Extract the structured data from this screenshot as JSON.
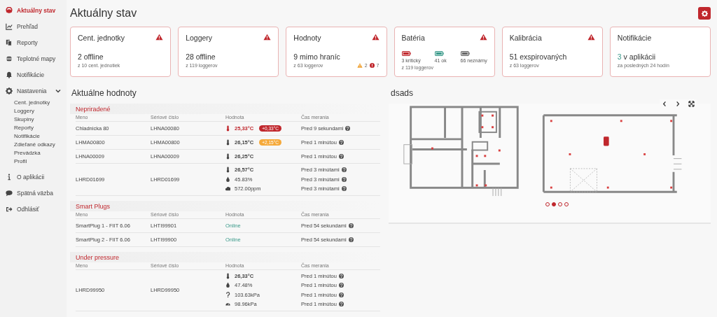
{
  "sidebar": {
    "items": [
      {
        "label": "Aktuálny stav",
        "selected": true
      },
      {
        "label": "Prehľad",
        "selected": false
      },
      {
        "label": "Reporty",
        "selected": false
      },
      {
        "label": "Teplotné mapy",
        "selected": false
      },
      {
        "label": "Notifikácie",
        "selected": false
      },
      {
        "label": "Nastavenia",
        "selected": false,
        "expanded": true,
        "children": [
          {
            "label": "Cent. jednotky",
            "selected": false
          },
          {
            "label": "Loggery",
            "selected": false
          },
          {
            "label": "Skupiny",
            "selected": false
          },
          {
            "label": "Reporty",
            "selected": false
          },
          {
            "label": "Notifikácie",
            "selected": false
          },
          {
            "label": "Zdieľané odkazy",
            "selected": false
          },
          {
            "label": "Prevádzka",
            "selected": false
          },
          {
            "label": "Profil",
            "selected": false
          }
        ]
      },
      {
        "label": "O aplikácii",
        "selected": false
      },
      {
        "label": "Spätná väzba",
        "selected": false
      },
      {
        "label": "Odhlásiť",
        "selected": false
      }
    ]
  },
  "page": {
    "title": "Aktuálny stav"
  },
  "cards": [
    {
      "kind": "stat",
      "title": "Cent. jednotky",
      "alert": true,
      "main": "2 offline",
      "sub": "z 10 cent. jednotiek"
    },
    {
      "kind": "stat",
      "title": "Loggery",
      "alert": true,
      "main": "28 offline",
      "sub": "z 119 loggerov"
    },
    {
      "kind": "stat",
      "title": "Hodnoty",
      "alert": true,
      "main": "9 mimo hraníc",
      "sub": "z 63 loggerov",
      "warnings": "2",
      "errors": "7"
    },
    {
      "kind": "battery",
      "title": "Batéria",
      "alert": true,
      "stats": [
        {
          "color": "#c0272d",
          "label": "3 kritický"
        },
        {
          "color": "#3a9a8a",
          "label": "41 ok"
        },
        {
          "color": "#666666",
          "label": "66 neznámy"
        }
      ],
      "sub": "z 119 loggerov"
    },
    {
      "kind": "stat",
      "title": "Kalibrácia",
      "alert": true,
      "main": "51 exspirovaných",
      "sub": "z 63 loggerov"
    },
    {
      "kind": "notify",
      "title": "Notifikácie",
      "alert": false,
      "count": "3",
      "main": "v aplikácii",
      "sub": "za posledných 24 hodín"
    }
  ],
  "values_section": {
    "title": "Aktuálne hodnoty",
    "groups": [
      {
        "title": "Nepriradené",
        "columns": [
          "Meno",
          "Sériové číslo",
          "Hodnota",
          "Čas merania"
        ],
        "rows": [
          {
            "name": "Chladnicka 80",
            "serial": "LHNA00080",
            "values": [
              {
                "kind": "temperature",
                "color": "#c0272d",
                "text": "25,33°C",
                "badge": {
                  "text": "+0,33°C",
                  "color": "#c0272d"
                },
                "time": "Pred 9 sekundami"
              }
            ]
          },
          {
            "name": "LHMA00800",
            "serial": "LHMA00800",
            "values": [
              {
                "kind": "temperature",
                "text": "26,15°C",
                "badge": {
                  "text": "+2,15°C",
                  "color": "#f5a93a"
                },
                "time": "Pred 1 minútou"
              }
            ]
          },
          {
            "name": "LHNA00009",
            "serial": "LHNA00009",
            "values": [
              {
                "kind": "temperature",
                "text": "26,25°C",
                "time": "Pred 1 minútou"
              }
            ]
          },
          {
            "name": "LHRD01699",
            "serial": "LHRD01699",
            "values": [
              {
                "kind": "temperature",
                "text": "26,57°C",
                "time": "Pred 3 minútami"
              },
              {
                "kind": "humidity",
                "text": "45.83%",
                "time": "Pred 3 minútami"
              },
              {
                "kind": "co2",
                "text": "572.00ppm",
                "time": "Pred 3 minútami"
              }
            ]
          }
        ]
      },
      {
        "title": "Smart Plugs",
        "columns": [
          "Meno",
          "Sériové číslo",
          "Hodnota",
          "Čas merania"
        ],
        "rows": [
          {
            "name": "SmartPlug 1 - FIIT 6.06",
            "serial": "LHTI99901",
            "values": [
              {
                "kind": "online",
                "text": "Online",
                "time": "Pred 54 sekundami"
              }
            ]
          },
          {
            "name": "SmartPlug 2 - FIIT 6.06",
            "serial": "LHTI99900",
            "values": [
              {
                "kind": "online",
                "text": "Online",
                "time": "Pred 54 sekundami"
              }
            ]
          }
        ]
      },
      {
        "title": "Under pressure",
        "columns": [
          "Meno",
          "Sériové číslo",
          "Hodnota",
          "Čas merania"
        ],
        "rows": [
          {
            "name": "LHRD99950",
            "serial": "LHRD99950",
            "values": [
              {
                "kind": "temperature",
                "text": "26,33°C",
                "time": "Pred 1 minútou"
              },
              {
                "kind": "humidity",
                "text": "47.48%",
                "time": "Pred 1 minútou"
              },
              {
                "kind": "unknown",
                "text": "103.63kPa",
                "time": "Pred 1 minútou"
              },
              {
                "kind": "pressure",
                "text": "98.96kPa",
                "time": "Pred 1 minútou"
              }
            ]
          }
        ]
      }
    ]
  },
  "plan_panel": {
    "title": "dsads",
    "slides": [
      {
        "selected": false
      },
      {
        "selected": true
      },
      {
        "selected": false
      },
      {
        "selected": false
      }
    ]
  }
}
